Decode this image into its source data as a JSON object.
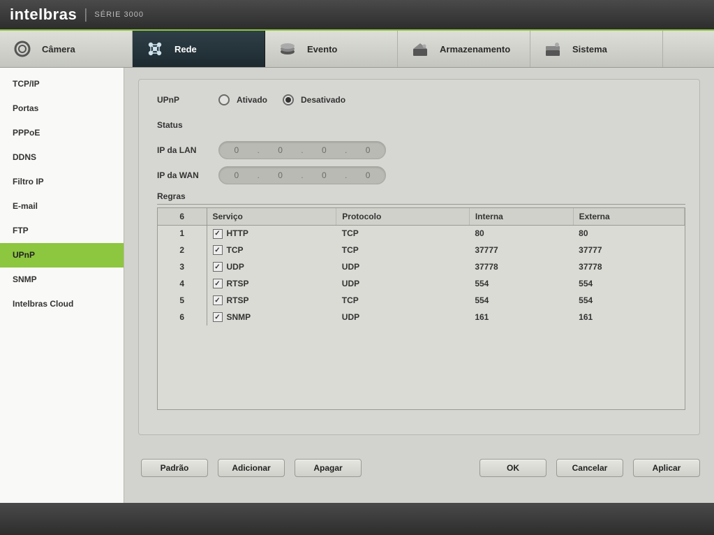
{
  "brand": {
    "name": "intelbras",
    "series": "SÉRIE 3000"
  },
  "nav": [
    {
      "label": "Câmera",
      "active": false
    },
    {
      "label": "Rede",
      "active": true
    },
    {
      "label": "Evento",
      "active": false
    },
    {
      "label": "Armazenamento",
      "active": false
    },
    {
      "label": "Sistema",
      "active": false
    }
  ],
  "sidebar": [
    "TCP/IP",
    "Portas",
    "PPPoE",
    "DDNS",
    "Filtro IP",
    "E-mail",
    "FTP",
    "UPnP",
    "SNMP",
    "Intelbras Cloud"
  ],
  "sidebar_active_index": 7,
  "upnp": {
    "title": "UPnP",
    "status_label": "Status",
    "ip_lan_label": "IP da LAN",
    "ip_wan_label": "IP da WAN",
    "radio_on": "Ativado",
    "radio_off": "Desativado",
    "radio_selected": "off",
    "ip_lan": [
      "0",
      "0",
      "0",
      "0"
    ],
    "ip_wan": [
      "0",
      "0",
      "0",
      "0"
    ],
    "rules_label": "Regras",
    "table": {
      "count_header": "6",
      "headers": [
        "Serviço",
        "Protocolo",
        "Interna",
        "Externa"
      ],
      "rows": [
        {
          "n": "1",
          "service": "HTTP",
          "proto": "TCP",
          "int": "80",
          "ext": "80",
          "checked": true
        },
        {
          "n": "2",
          "service": "TCP",
          "proto": "TCP",
          "int": "37777",
          "ext": "37777",
          "checked": true
        },
        {
          "n": "3",
          "service": "UDP",
          "proto": "UDP",
          "int": "37778",
          "ext": "37778",
          "checked": true
        },
        {
          "n": "4",
          "service": "RTSP",
          "proto": "UDP",
          "int": "554",
          "ext": "554",
          "checked": true
        },
        {
          "n": "5",
          "service": "RTSP",
          "proto": "TCP",
          "int": "554",
          "ext": "554",
          "checked": true
        },
        {
          "n": "6",
          "service": "SNMP",
          "proto": "UDP",
          "int": "161",
          "ext": "161",
          "checked": true
        }
      ]
    }
  },
  "buttons": {
    "default": "Padrão",
    "add": "Adicionar",
    "delete": "Apagar",
    "ok": "OK",
    "cancel": "Cancelar",
    "apply": "Aplicar"
  }
}
